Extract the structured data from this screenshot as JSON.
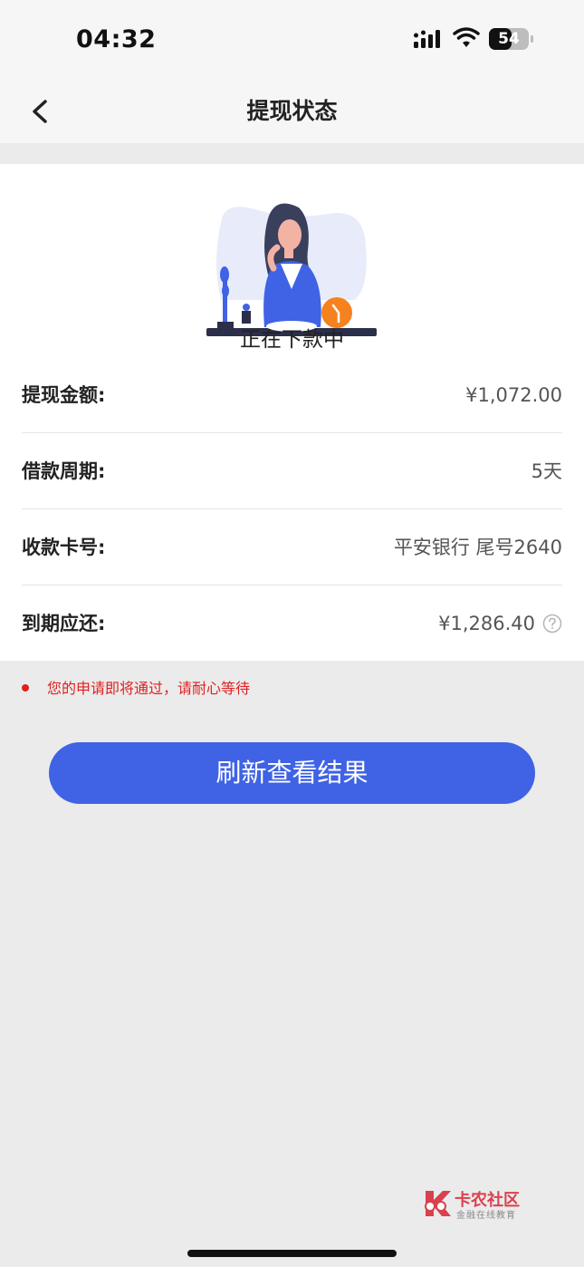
{
  "status_bar": {
    "time": "04:32",
    "battery": "54"
  },
  "nav": {
    "title": "提现状态"
  },
  "status": {
    "text": "正在下款中"
  },
  "details": [
    {
      "label": "提现金额:",
      "value": "¥1,072.00"
    },
    {
      "label": "借款周期:",
      "value": "5天"
    },
    {
      "label": "收款卡号:",
      "value": "平安银行 尾号2640"
    },
    {
      "label": "到期应还:",
      "value": "¥1,286.40"
    }
  ],
  "notice": {
    "text": "您的申请即将通过，请耐心等待"
  },
  "refresh_button": {
    "label": "刷新查看结果"
  },
  "watermark": {
    "title": "卡农社区",
    "subtitle": "金融在线教育"
  },
  "colors": {
    "accent": "#3f63e4",
    "notice": "#e02020",
    "illustration_orange": "#f5821f"
  }
}
